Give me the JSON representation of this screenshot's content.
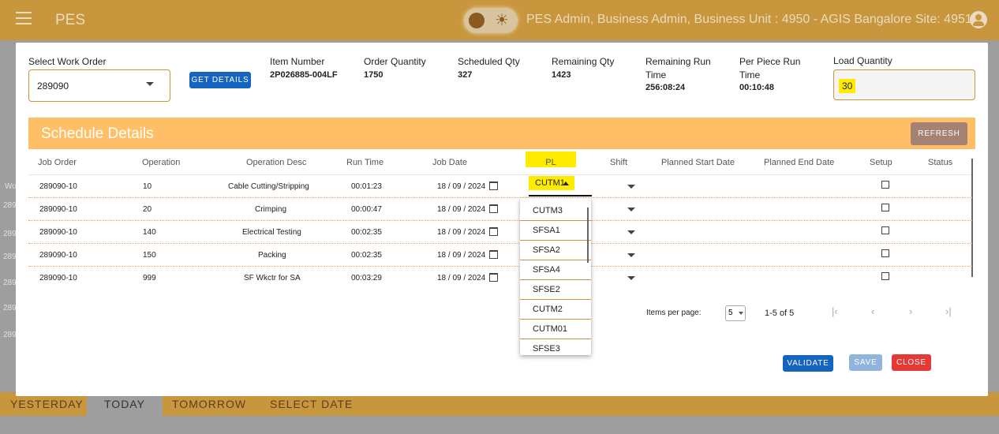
{
  "app": {
    "title": "PES",
    "user_info": "PES Admin, Business Admin, Business Unit : 4950 - AGIS Bangalore Site: 49510"
  },
  "icons": {
    "menu": "menu-icon",
    "theme": "sun-icon",
    "user": "account-icon",
    "calendar": "calendar-icon"
  },
  "background": {
    "row_fragments": [
      "Wo",
      "289",
      "289",
      "289",
      "289",
      "289",
      "289"
    ],
    "tabs": [
      "YESTERDAY",
      "TODAY",
      "TOMORROW",
      "SELECT DATE"
    ]
  },
  "header": {
    "work_order_label": "Select Work Order",
    "work_order_value": "289090",
    "get_details": "GET DETAILS",
    "item_number_label": "Item Number",
    "item_number": "2P026885-004LF",
    "order_qty_label": "Order Quantity",
    "order_qty": "1750",
    "scheduled_qty_label": "Scheduled Qty",
    "scheduled_qty": "327",
    "remaining_qty_label": "Remaining Qty",
    "remaining_qty": "1423",
    "remaining_run_label_1": "Remaining Run",
    "remaining_run_label_2": "Time",
    "remaining_run_time": "256:08:24",
    "per_piece_label_1": "Per Piece Run",
    "per_piece_label_2": "Time",
    "per_piece_time": "00:10:48",
    "load_qty_label": "Load Quantity",
    "load_qty": "30"
  },
  "schedule": {
    "title": "Schedule Details",
    "refresh": "REFRESH",
    "columns": [
      "Job Order",
      "Operation",
      "Operation Desc",
      "Run Time",
      "Job Date",
      "PL",
      "Shift",
      "Planned Start Date",
      "Planned End Date",
      "Setup",
      "Status"
    ],
    "rows": [
      {
        "job_order": "289090-10",
        "operation": "10",
        "desc": "Cable Cutting/Stripping",
        "run_time": "00:01:23",
        "job_date": "18 / 09 / 2024",
        "pl": "CUTM1"
      },
      {
        "job_order": "289090-10",
        "operation": "20",
        "desc": "Crimping",
        "run_time": "00:00:47",
        "job_date": "18 / 09 / 2024",
        "pl": ""
      },
      {
        "job_order": "289090-10",
        "operation": "140",
        "desc": "Electrical Testing",
        "run_time": "00:02:35",
        "job_date": "18 / 09 / 2024",
        "pl": ""
      },
      {
        "job_order": "289090-10",
        "operation": "150",
        "desc": "Packing",
        "run_time": "00:02:35",
        "job_date": "18 / 09 / 2024",
        "pl": ""
      },
      {
        "job_order": "289090-10",
        "operation": "999",
        "desc": "SF Wkctr for SA",
        "run_time": "00:03:29",
        "job_date": "18 / 09 / 2024",
        "pl": ""
      }
    ],
    "pl_options": [
      "CUTM3",
      "SFSA1",
      "SFSA2",
      "SFSA4",
      "SFSE2",
      "CUTM2",
      "CUTM01",
      "SFSE3"
    ]
  },
  "pager": {
    "items_label": "Items per page:",
    "page_size": "5",
    "range": "1-5 of 5",
    "first": "|‹",
    "prev": "‹",
    "next": "›",
    "last": "›|"
  },
  "actions": {
    "validate": "VALIDATE",
    "save": "SAVE",
    "close": "CLOSE"
  },
  "colors": {
    "accent": "#c8963c",
    "header_bar": "#ffbf66",
    "highlight": "#ffeb00",
    "primary": "#1565c0",
    "danger": "#e53935"
  }
}
